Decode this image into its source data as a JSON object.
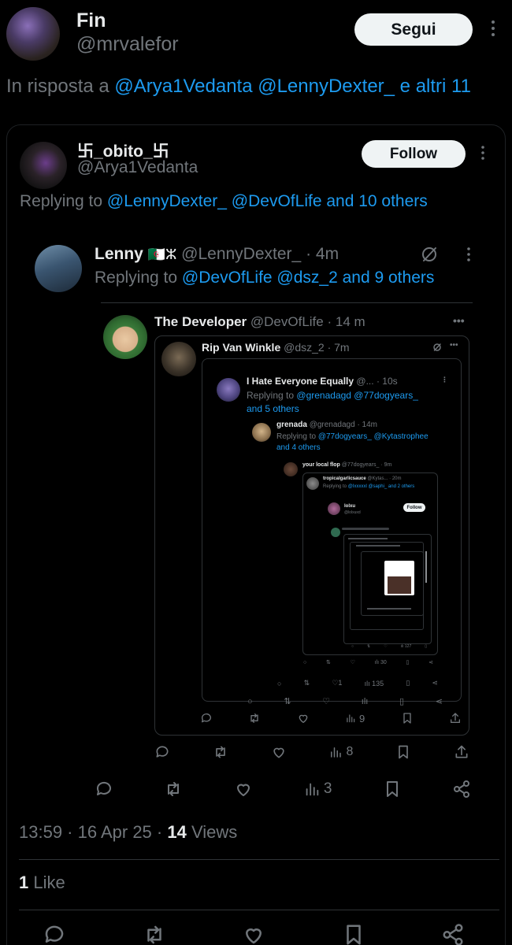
{
  "main_post": {
    "display_name": "Fin",
    "handle": "@mrvalefor",
    "follow_label": "Segui",
    "reply_prefix": "In risposta a",
    "reply_mentions": "@Arya1Vedanta @LennyDexter_ e altri 11",
    "timestamp": "13:59 · 16 Apr 25 · ",
    "views_count": "14",
    "views_label": " Views",
    "likes_count": "1",
    "likes_label": " Like"
  },
  "quoted_screenshot": {
    "level1": {
      "display_name": "卐_obito_卐",
      "handle": "@Arya1Vedanta",
      "follow_label": "Follow",
      "reply_prefix": "Replying to",
      "reply_mentions": "@LennyDexter_ @DevOfLife and 10 others",
      "views": "3"
    },
    "level2": {
      "display_name": "Lenny",
      "flag": "🇩🇿ⵣ",
      "handle": "@LennyDexter_",
      "time": "· 4m",
      "reply_prefix": "Replying to",
      "reply_mentions": "@DevOfLife @dsz_2 and 9 others",
      "views": "8"
    },
    "level3": {
      "display_name": "The Developer",
      "handle": "@DevOfLife",
      "time": "· 14 m",
      "views": "9"
    },
    "level4": {
      "display_name": "Rip Van Winkle",
      "handle": "@dsz_2",
      "time": "· 7m"
    },
    "level5": {
      "display_name": "I Hate Everyone Equally",
      "handle": "@...",
      "time": "· 10s",
      "reply_prefix": "Replying to",
      "reply_mentions_1": "@grenadagd @77dogyears_",
      "reply_mentions_2": "and 5 others"
    },
    "level6": {
      "display_name": "grenada",
      "handle": "@grenadagd",
      "time": "· 14m",
      "reply_prefix": "Replying to",
      "reply_mentions_1": "@77dogyears_ @Kytastrophee",
      "reply_mentions_2": "and 4 others",
      "likes": "1",
      "views": "135"
    },
    "level7": {
      "display_name": "your local flop",
      "handle": "@77dogyears_",
      "time": "· 9m"
    },
    "level8": {
      "display_name": "tropicalgarlicsauce",
      "handle": "@Kytas...",
      "time": "· 20m",
      "reply_prefix": "Replying to",
      "reply_mentions": "@Ixxxxxl @saphi_ and 2 others",
      "views": "30"
    },
    "level9": {
      "display_name": "lolxu",
      "handle": "@lolxuxd",
      "follow_label": "Follow",
      "views": "127"
    }
  },
  "icons": [
    "reply-icon",
    "repost-icon",
    "like-icon",
    "views-icon",
    "bookmark-icon",
    "share-icon",
    "more-icon",
    "grok-icon"
  ],
  "colors": {
    "background": "#000000",
    "text": "#e7e9ea",
    "secondary": "#71767b",
    "link": "#1d9bf0",
    "button": "#eff3f4"
  }
}
